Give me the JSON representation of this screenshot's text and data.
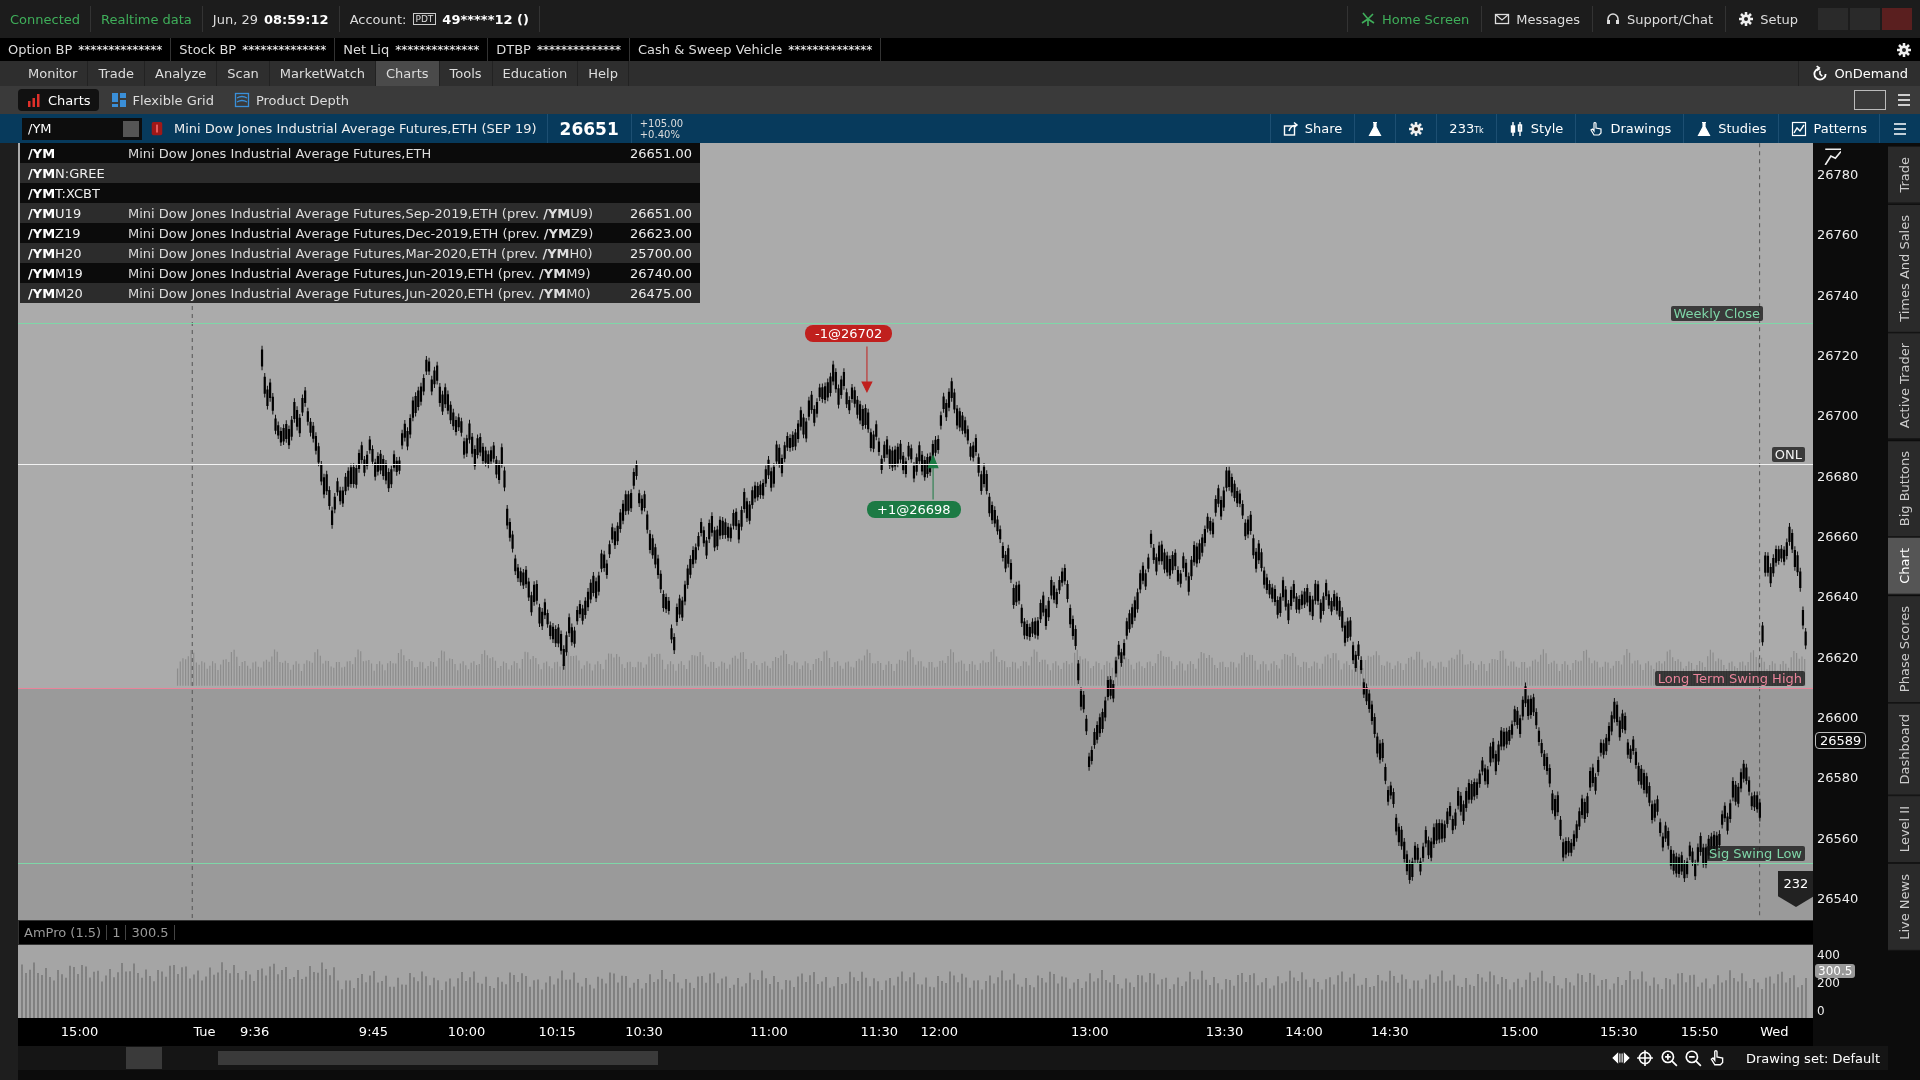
{
  "status": {
    "connected": "Connected",
    "data_feed": "Realtime data",
    "date": "Jun, 29",
    "time": "08:59:12",
    "account_label": "Account:",
    "pdt_badge": "PDT",
    "account": "49*****12 ()"
  },
  "top_links": [
    {
      "label": "Home Screen",
      "kind": "home"
    },
    {
      "label": "Messages",
      "kind": "mail"
    },
    {
      "label": "Support/Chat",
      "kind": "headset"
    },
    {
      "label": "Setup",
      "kind": "gear"
    }
  ],
  "balances": [
    {
      "label": "Option BP",
      "value": "**************"
    },
    {
      "label": "Stock BP",
      "value": "**************"
    },
    {
      "label": "Net Liq",
      "value": "**************"
    },
    {
      "label": "DTBP",
      "value": "**************"
    },
    {
      "label": "Cash & Sweep Vehicle",
      "value": "**************"
    }
  ],
  "main_tabs": [
    {
      "label": "Monitor",
      "selected": false
    },
    {
      "label": "Trade",
      "selected": false
    },
    {
      "label": "Analyze",
      "selected": false
    },
    {
      "label": "Scan",
      "selected": false
    },
    {
      "label": "MarketWatch",
      "selected": false
    },
    {
      "label": "Charts",
      "selected": true
    },
    {
      "label": "Tools",
      "selected": false
    },
    {
      "label": "Education",
      "selected": false
    },
    {
      "label": "Help",
      "selected": false
    }
  ],
  "ondemand": "OnDemand",
  "sub_tabs": [
    {
      "label": "Charts",
      "kind": "bars",
      "selected": true
    },
    {
      "label": "Flexible Grid",
      "kind": "grid",
      "selected": false
    },
    {
      "label": "Product Depth",
      "kind": "depth",
      "selected": false
    }
  ],
  "symbol_bar": {
    "symbol": "/YM",
    "description": "Mini Dow Jones Industrial Average Futures,ETH (SEP 19)",
    "last": "26651",
    "change": "+105.00",
    "change_pct": "+0.40%"
  },
  "toolbar": [
    {
      "kind": "share",
      "label": "Share"
    },
    {
      "kind": "flask"
    },
    {
      "kind": "gear"
    },
    {
      "kind": "ticks",
      "label": "233",
      "unit": "Tk"
    },
    {
      "kind": "style",
      "label": "Style"
    },
    {
      "kind": "hand",
      "label": "Drawings"
    },
    {
      "kind": "flask",
      "label": "Studies"
    },
    {
      "kind": "patterns",
      "label": "Patterns"
    },
    {
      "kind": "menu"
    }
  ],
  "suggestions": [
    {
      "match": "/YM",
      "description": "Mini Dow Jones Industrial Average Futures,ETH",
      "price": "26651.00"
    },
    {
      "match": "/YM",
      "rest": "N:GREE"
    },
    {
      "match": "/YM",
      "rest": "T:XCBT"
    },
    {
      "match": "/YM",
      "rest": "U19",
      "description": "Mini Dow Jones Industrial Average Futures,Sep-2019,ETH (prev. **/YM**U9)",
      "price": "26651.00"
    },
    {
      "match": "/YM",
      "rest": "Z19",
      "description": "Mini Dow Jones Industrial Average Futures,Dec-2019,ETH (prev. **/YM**Z9)",
      "price": "26623.00"
    },
    {
      "match": "/YM",
      "rest": "H20",
      "description": "Mini Dow Jones Industrial Average Futures,Mar-2020,ETH (prev. **/YM**H0)",
      "price": "25700.00"
    },
    {
      "match": "/YM",
      "rest": "M19",
      "description": "Mini Dow Jones Industrial Average Futures,Jun-2019,ETH (prev. **/YM**M9)",
      "price": "26740.00"
    },
    {
      "match": "/YM",
      "rest": "M20",
      "description": "Mini Dow Jones Industrial Average Futures,Jun-2020,ETH (prev. **/YM**M0)",
      "price": "26475.00"
    }
  ],
  "levels": [
    {
      "label": "Weekly Close",
      "color": "#7fd6a8"
    },
    {
      "label": "ONL",
      "color": "#f2f2f2"
    },
    {
      "label": "Long Term Swing High",
      "color": "#e9849a"
    },
    {
      "label": "Sig Swing Low",
      "color": "#7fd6a8"
    }
  ],
  "orders": [
    {
      "label": "-1@26702",
      "kind": "sell"
    },
    {
      "label": "+1@26698",
      "kind": "buy"
    }
  ],
  "price_axis": [
    "26780",
    "26760",
    "26740",
    "26720",
    "26700",
    "26680",
    "26660",
    "26640",
    "26620",
    "26600",
    "26580",
    "26560",
    "26540"
  ],
  "price_tag": "26589",
  "bar_count": "232",
  "lower_study": {
    "name": "AmPro (1.5)",
    "param": "1",
    "value": "300.5",
    "axis": [
      "400",
      "200",
      "0"
    ],
    "tag": "300.5"
  },
  "time_axis": [
    "15:00",
    "Tue",
    "9:36",
    "9:45",
    "10:00",
    "10:15",
    "10:30",
    "11:00",
    "11:30",
    "12:00",
    "13:00",
    "13:30",
    "14:00",
    "14:30",
    "15:00",
    "15:30",
    "15:50",
    "Wed"
  ],
  "drawing_set": "Drawing set: Default",
  "side_tabs": [
    {
      "label": "Trade",
      "selected": false
    },
    {
      "label": "Times And Sales",
      "selected": false
    },
    {
      "label": "Active Trader",
      "selected": false
    },
    {
      "label": "Big Buttons",
      "selected": false
    },
    {
      "label": "Chart",
      "selected": true
    },
    {
      "label": "Phase Scores",
      "selected": false
    },
    {
      "label": "Dashboard",
      "selected": false
    },
    {
      "label": "Level II",
      "selected": false
    },
    {
      "label": "Live News",
      "selected": false
    }
  ]
}
